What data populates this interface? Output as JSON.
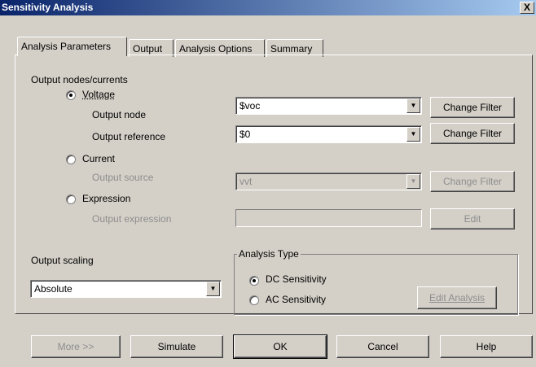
{
  "window": {
    "title": "Sensitivity Analysis",
    "close_glyph": "X"
  },
  "tabs": [
    {
      "label": "Analysis Parameters",
      "active": true
    },
    {
      "label": "Output",
      "active": false
    },
    {
      "label": "Analysis Options",
      "active": false
    },
    {
      "label": "Summary",
      "active": false
    }
  ],
  "output_nodes": {
    "heading": "Output nodes/currents",
    "voltage": {
      "label": "Voltage",
      "selected": true,
      "output_node": {
        "label": "Output node",
        "value": "$voc",
        "button": "Change Filter"
      },
      "output_reference": {
        "label": "Output reference",
        "value": "$0",
        "button": "Change Filter"
      }
    },
    "current": {
      "label": "Current",
      "selected": false,
      "output_source": {
        "label": "Output source",
        "value": "vvt",
        "button": "Change Filter"
      }
    },
    "expression": {
      "label": "Expression",
      "selected": false,
      "output_expression": {
        "label": "Output expression",
        "value": "",
        "button": "Edit"
      }
    }
  },
  "output_scaling": {
    "label": "Output scaling",
    "value": "Absolute"
  },
  "analysis_type": {
    "legend": "Analysis Type",
    "options": [
      {
        "label": "DC Sensitivity",
        "selected": true
      },
      {
        "label": "AC Sensitivity",
        "selected": false
      }
    ],
    "edit_button": "Edit Analysis"
  },
  "footer": {
    "more": "More >>",
    "simulate": "Simulate",
    "ok": "OK",
    "cancel": "Cancel",
    "help": "Help"
  },
  "colors": {
    "dialog_bg": "#d4d0c8",
    "titlebar": "#0a246a",
    "disabled_text": "#8d8d8d"
  }
}
